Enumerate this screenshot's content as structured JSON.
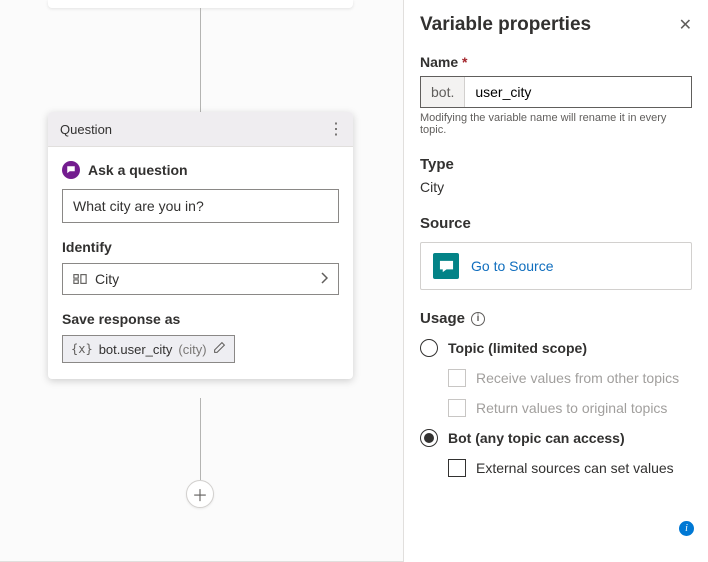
{
  "question_node": {
    "header": "Question",
    "ask_label": "Ask a question",
    "question_text": "What city are you in?",
    "identify_label": "Identify",
    "identify_value": "City",
    "save_label": "Save response as",
    "var_prefix": "{x}",
    "var_name": "bot.user_city",
    "var_type_paren": "(city)"
  },
  "panel": {
    "title": "Variable properties",
    "name_label": "Name",
    "name_prefix": "bot.",
    "name_value": "user_city",
    "name_hint": "Modifying the variable name will rename it in every topic.",
    "type_label": "Type",
    "type_value": "City",
    "source_label": "Source",
    "source_link": "Go to Source",
    "usage_label": "Usage",
    "usage_options": {
      "topic": "Topic (limited scope)",
      "receive": "Receive values from other topics",
      "return": "Return values to original topics",
      "bot": "Bot (any topic can access)",
      "external": "External sources can set values"
    }
  }
}
